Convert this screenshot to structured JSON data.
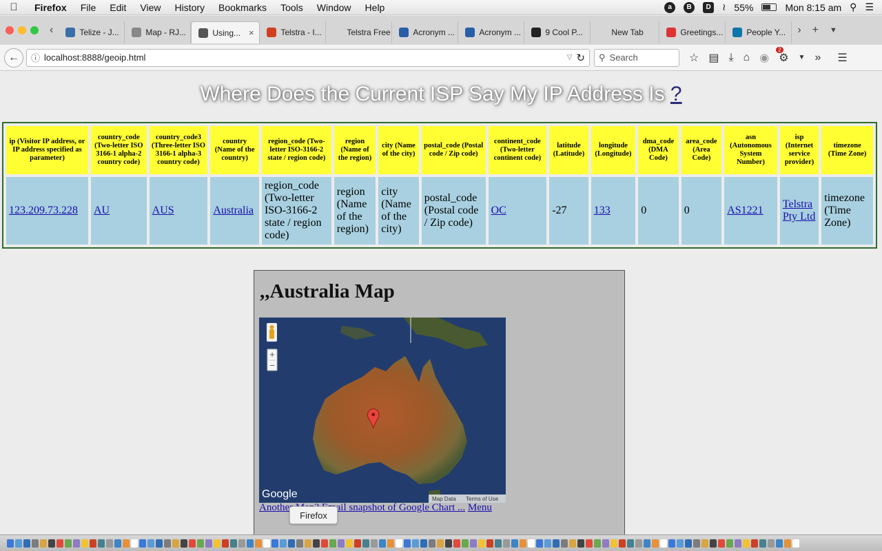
{
  "menubar": {
    "app": "Firefox",
    "items": [
      "File",
      "Edit",
      "View",
      "History",
      "Bookmarks",
      "Tools",
      "Window",
      "Help"
    ],
    "battery": "55%",
    "clock": "Mon 8:15 am"
  },
  "tabs": [
    {
      "label": "Telize - J...",
      "color": "#3a6ea8"
    },
    {
      "label": "Map - RJ...",
      "color": "#888888"
    },
    {
      "label": "Using...",
      "color": "#555555",
      "active": true
    },
    {
      "label": "Telstra - I...",
      "color": "#d04020"
    },
    {
      "label": "Telstra Free ...",
      "color": ""
    },
    {
      "label": "Acronym ...",
      "color": "#2a5da8"
    },
    {
      "label": "Acronym ...",
      "color": "#2a5da8"
    },
    {
      "label": "9 Cool P...",
      "color": "#222222"
    },
    {
      "label": "New Tab",
      "color": ""
    },
    {
      "label": "Greetings...",
      "color": "#d33"
    },
    {
      "label": "People Y...",
      "color": "#0e76a8"
    }
  ],
  "navbar": {
    "url": "localhost:8888/geoip.html",
    "search_placeholder": "Search",
    "badge": "2"
  },
  "page": {
    "title": "Where Does the Current ISP Say My IP Address Is",
    "title_link": "?",
    "table": {
      "headers": [
        "ip (Visitor IP address, or IP address specified as parameter)",
        "country_code (Two-letter ISO 3166-1 alpha-2 country code)",
        "country_code3 (Three-letter ISO 3166-1 alpha-3 country code)",
        "country (Name of the country)",
        "region_code (Two-letter ISO-3166-2 state / region code)",
        "region (Name of the region)",
        "city (Name of the city)",
        "postal_code (Postal code / Zip code)",
        "continent_code (Two-letter continent code)",
        "latitude (Latitude)",
        "longitude (Longitude)",
        "dma_code (DMA Code)",
        "area_code (Area Code)",
        "asn (Autonomous System Number)",
        "isp (Internet service provider)",
        "timezone (Time Zone)"
      ],
      "cells": [
        {
          "text": "123.209.73.228",
          "link": true
        },
        {
          "text": "AU",
          "link": true
        },
        {
          "text": "AUS",
          "link": true
        },
        {
          "text": "Australia",
          "link": true
        },
        {
          "text": "region_code (Two-letter ISO-3166-2 state / region code)",
          "link": false
        },
        {
          "text": "region (Name of the region)",
          "link": false
        },
        {
          "text": "city (Name of the city)",
          "link": false
        },
        {
          "text": "postal_code (Postal code / Zip code)",
          "link": false
        },
        {
          "text": "OC",
          "link": true
        },
        {
          "text": "-27",
          "link": false
        },
        {
          "text": "133",
          "link": true
        },
        {
          "text": "0",
          "link": false
        },
        {
          "text": "0",
          "link": false
        },
        {
          "text": "AS1221",
          "link": true
        },
        {
          "text": "Telstra Pty Ltd",
          "link": true
        },
        {
          "text": "timezone (Time Zone)",
          "link": false
        }
      ]
    },
    "map": {
      "heading": ",,Australia Map",
      "google_logo": "Google",
      "map_data": "Map Data",
      "terms": "Terms of Use",
      "zoom_in": "+",
      "zoom_out": "−",
      "marker_lat": -27,
      "marker_lon": 133
    },
    "links": {
      "another": "Another Map?",
      "email": "Email snapshot of Google Chart ...",
      "menu": "Menu"
    },
    "tooltip": "Firefox"
  }
}
